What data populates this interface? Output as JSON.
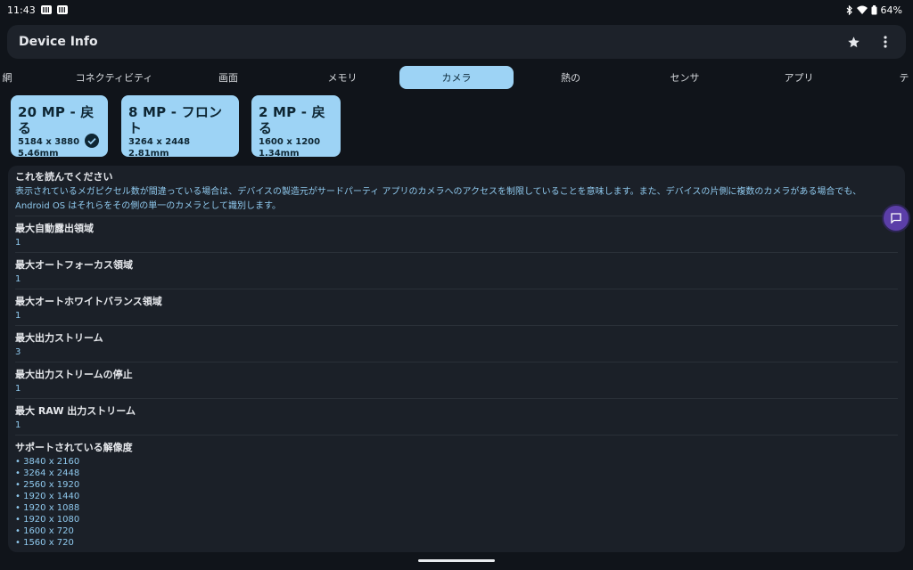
{
  "status": {
    "time": "11:43",
    "battery": "64%"
  },
  "appbar": {
    "title": "Device Info",
    "favorite_icon": "star-icon",
    "menu_icon": "more-vert-icon"
  },
  "tabs": [
    {
      "label": "網"
    },
    {
      "label": "コネクティビティ"
    },
    {
      "label": "画面"
    },
    {
      "label": "メモリ"
    },
    {
      "label": "カメラ",
      "active": true
    },
    {
      "label": "熱の"
    },
    {
      "label": "センサ"
    },
    {
      "label": "アプリ"
    },
    {
      "label": "テ"
    }
  ],
  "cameras": [
    {
      "title": "20 MP - 戻る",
      "resolution": "5184 x 3880",
      "focal": "5.46mm",
      "selected": true
    },
    {
      "title": "8 MP - フロント",
      "resolution": "3264 x 2448",
      "focal": "2.81mm",
      "selected": false
    },
    {
      "title": "2 MP - 戻る",
      "resolution": "1600 x 1200",
      "focal": "1.34mm",
      "selected": false
    }
  ],
  "notice": {
    "title": "これを読んでください",
    "body": "表示されているメガピクセル数が間違っている場合は、デバイスの製造元がサードパーティ アプリのカメラへのアクセスを制限していることを意味します。また、デバイスの片側に複数のカメラがある場合でも、Android OS はそれらをその側の単一のカメラとして識別します。"
  },
  "properties": [
    {
      "label": "最大自動露出領域",
      "value": "1"
    },
    {
      "label": "最大オートフォーカス領域",
      "value": "1"
    },
    {
      "label": "最大オートホワイトバランス領域",
      "value": "1"
    },
    {
      "label": "最大出力ストリーム",
      "value": "3"
    },
    {
      "label": "最大出力ストリームの停止",
      "value": "1"
    },
    {
      "label": "最大 RAW 出力ストリーム",
      "value": "1"
    }
  ],
  "resolutions": {
    "label": "サポートされている解像度",
    "items": [
      "• 3840 x 2160",
      "• 3264 x 2448",
      "• 2560 x 1920",
      "• 1920 x 1440",
      "• 1920 x 1088",
      "• 1920 x 1080",
      "• 1600 x 720",
      "• 1560 x 720"
    ]
  },
  "colors": {
    "background": "#10141a",
    "surface": "#1b2028",
    "accent": "#9dd3f5",
    "value_text": "#8fc9ee",
    "bubble": "#5b3ea8"
  }
}
